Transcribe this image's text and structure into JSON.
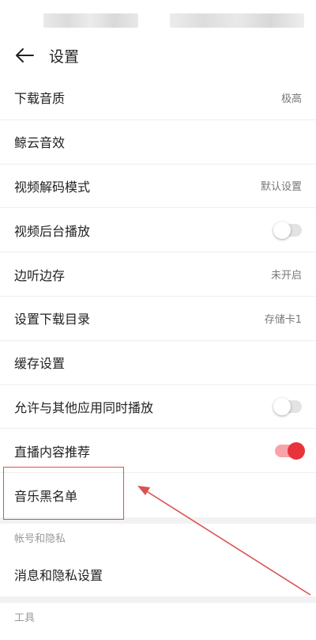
{
  "header": {
    "title": "设置"
  },
  "settings": [
    {
      "label": "下载音质",
      "value": "极高"
    },
    {
      "label": "鲸云音效",
      "value": ""
    },
    {
      "label": "视频解码模式",
      "value": "默认设置"
    },
    {
      "label": "视频后台播放",
      "toggle": false
    },
    {
      "label": "边听边存",
      "value": "未开启"
    },
    {
      "label": "设置下载目录",
      "value": "存储卡1"
    },
    {
      "label": "缓存设置",
      "value": ""
    },
    {
      "label": "允许与其他应用同时播放",
      "toggle": false
    },
    {
      "label": "直播内容推荐",
      "toggle": true
    },
    {
      "label": "音乐黑名单",
      "value": ""
    }
  ],
  "privacy_section": {
    "title": "帐号和隐私",
    "item": "消息和隐私设置"
  },
  "tools_section": {
    "title": "工具"
  },
  "colors": {
    "accent": "#e8333c",
    "annotation": "#d9534f"
  },
  "icons": {
    "back": "arrow-left-icon"
  }
}
